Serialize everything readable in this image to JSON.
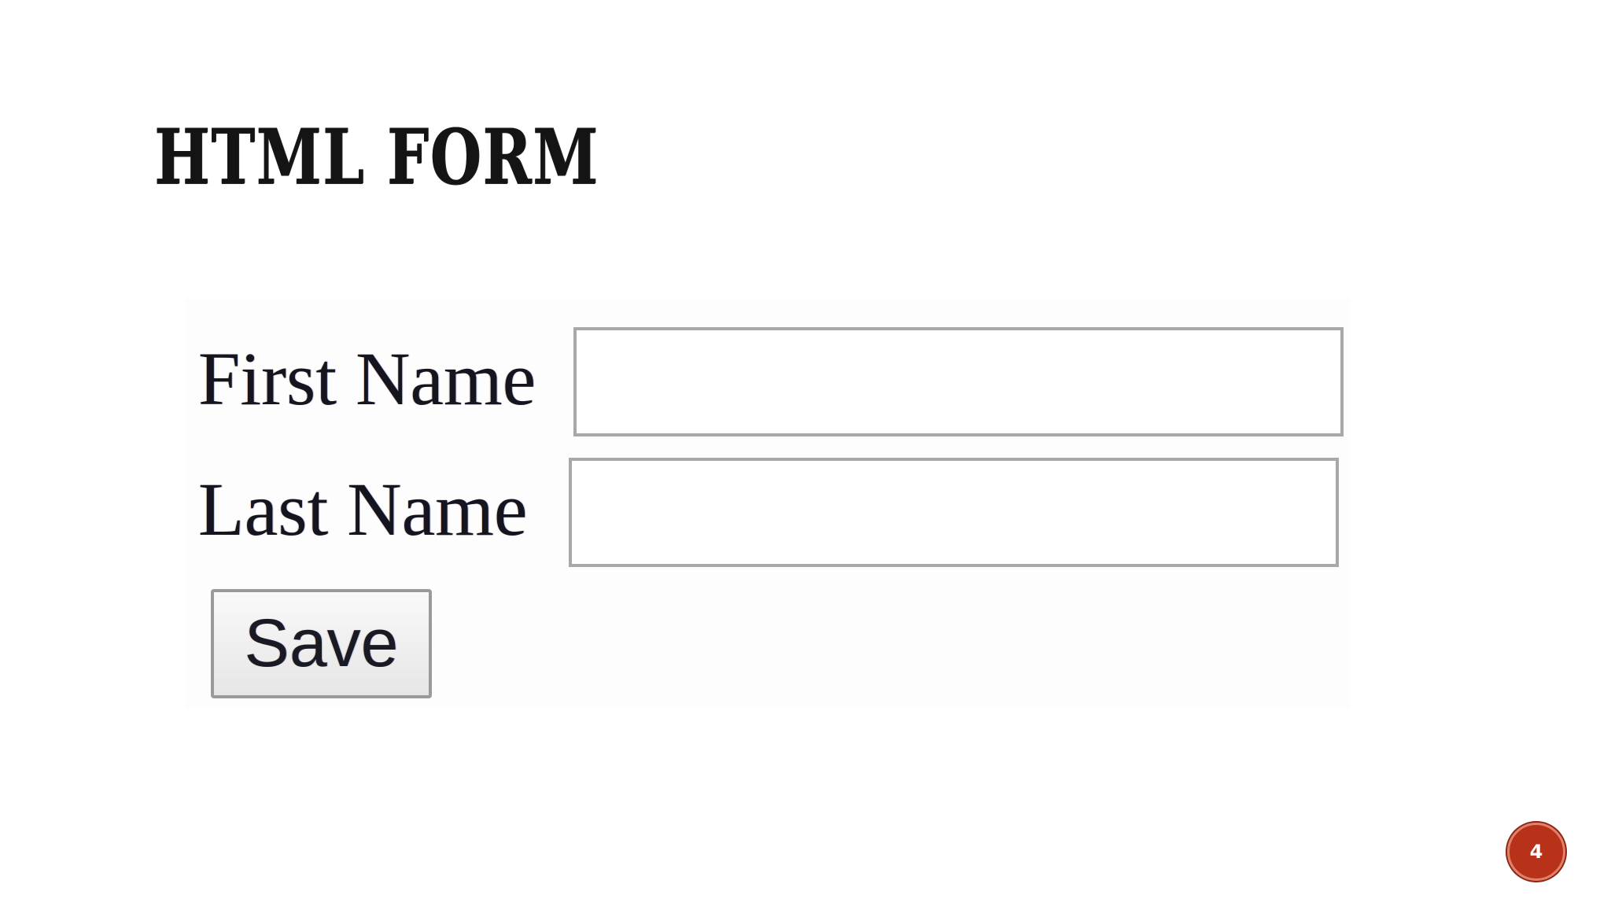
{
  "slide": {
    "title": "HTML FORM",
    "page_number": "4",
    "accent_color": "#b8321a"
  },
  "form": {
    "first_name": {
      "label": "First Name",
      "value": ""
    },
    "last_name": {
      "label": "Last Name",
      "value": ""
    },
    "save_label": "Save"
  }
}
